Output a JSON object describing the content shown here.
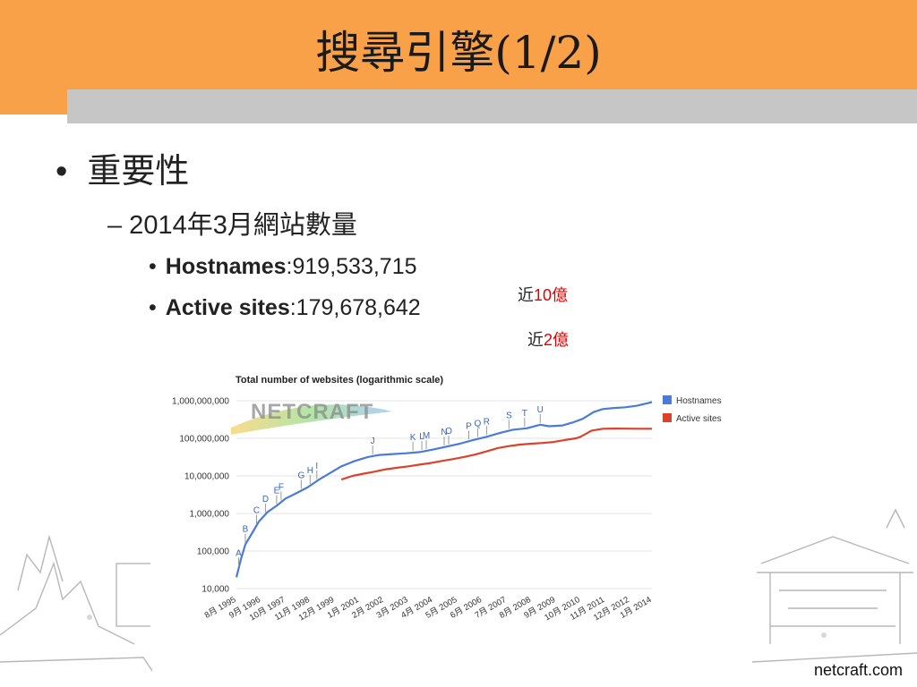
{
  "slide": {
    "title": "搜尋引擎(1/2)",
    "bullet1": "重要性",
    "bullet2": "– 2014年3月網站數量",
    "hostnames_label": "Hostnames",
    "hostnames_value": ":919,533,715",
    "active_label": "Active sites",
    "active_value": ":179,678,642",
    "note1_prefix": "近",
    "note1_num": "10",
    "note1_suffix": "億",
    "note2_prefix": "近",
    "note2_num": "2",
    "note2_suffix": "億",
    "source": "netcraft.com",
    "watermark": "NETCRAFT"
  },
  "colors": {
    "title_bar": "#f9a148",
    "gray_bar": "#c6c6c6",
    "hostnames": "#4a7bd6",
    "active": "#d9422b",
    "highlight": "#e00000"
  },
  "chart_data": {
    "type": "line",
    "title": "Total number of websites (logarithmic scale)",
    "xlabel": "",
    "ylabel": "",
    "yscale": "log",
    "ylim": [
      10000,
      1000000000
    ],
    "yticks": [
      1000000000,
      100000000,
      10000000,
      1000000,
      100000,
      10000
    ],
    "yticklabels": [
      "1,000,000,000",
      "100,000,000",
      "10,000,000",
      "1,000,000",
      "100,000",
      "10,000"
    ],
    "xlim": [
      1995.6,
      2014.2
    ],
    "xticks": [
      1995.6,
      1996.7,
      1997.8,
      1998.9,
      2000.0,
      2001.1,
      2002.2,
      2003.3,
      2004.4,
      2005.5,
      2006.6,
      2007.7,
      2008.8,
      2009.9,
      2011.0,
      2012.1,
      2013.2,
      2014.2
    ],
    "xticklabels": [
      "8月 1995",
      "9月 1996",
      "10月 1997",
      "11月 1998",
      "12月 1999",
      "1月 2001",
      "2月 2002",
      "3月 2003",
      "4月 2004",
      "5月 2005",
      "6月 2006",
      "7月 2007",
      "8月 2008",
      "9月 2009",
      "10月 2010",
      "11月 2011",
      "12月 2012",
      "1月 2014"
    ],
    "grid": true,
    "legend_position": "right",
    "series": [
      {
        "name": "Hostnames",
        "color": "#4a7bd6",
        "x": [
          1995.6,
          1995.8,
          1996.0,
          1996.3,
          1996.6,
          1997.0,
          1997.4,
          1997.8,
          1998.3,
          1998.8,
          1999.3,
          1999.8,
          2000.3,
          2000.9,
          2001.5,
          2002.0,
          2002.6,
          2003.2,
          2003.8,
          2004.4,
          2005.0,
          2005.6,
          2006.2,
          2006.8,
          2007.4,
          2008.0,
          2008.6,
          2009.2,
          2009.6,
          2010.2,
          2010.7,
          2011.1,
          2011.6,
          2012.0,
          2012.5,
          2013.0,
          2013.5,
          2014.0,
          2014.2
        ],
        "y": [
          20000,
          60000,
          150000,
          300000,
          600000,
          1100000,
          1600000,
          2500000,
          3500000,
          5000000,
          8000000,
          12000000,
          18000000,
          25000000,
          32000000,
          36000000,
          38000000,
          40000000,
          43000000,
          50000000,
          60000000,
          72000000,
          90000000,
          110000000,
          140000000,
          170000000,
          185000000,
          230000000,
          210000000,
          220000000,
          270000000,
          330000000,
          500000000,
          600000000,
          640000000,
          670000000,
          730000000,
          860000000,
          920000000
        ]
      },
      {
        "name": "Active sites",
        "color": "#d9422b",
        "x": [
          2000.3,
          2000.8,
          2001.3,
          2001.8,
          2002.3,
          2002.8,
          2003.3,
          2003.8,
          2004.3,
          2004.8,
          2005.3,
          2005.8,
          2006.3,
          2006.8,
          2007.3,
          2007.8,
          2008.3,
          2008.8,
          2009.3,
          2009.8,
          2010.3,
          2010.8,
          2011.0,
          2011.5,
          2012.0,
          2012.5,
          2013.0,
          2013.5,
          2014.0,
          2014.2
        ],
        "y": [
          8000000,
          10000000,
          11500000,
          13000000,
          15000000,
          16500000,
          18000000,
          20000000,
          22000000,
          25000000,
          28000000,
          32000000,
          37000000,
          45000000,
          55000000,
          62000000,
          68000000,
          72000000,
          75000000,
          80000000,
          90000000,
          100000000,
          110000000,
          160000000,
          180000000,
          182000000,
          181000000,
          180000000,
          180000000,
          179678642
        ]
      }
    ],
    "annotations": [
      {
        "label": "A",
        "x": 1995.7
      },
      {
        "label": "B",
        "x": 1996.0
      },
      {
        "label": "C",
        "x": 1996.5
      },
      {
        "label": "D",
        "x": 1996.9
      },
      {
        "label": "E",
        "x": 1997.4
      },
      {
        "label": "F",
        "x": 1997.6
      },
      {
        "label": "G",
        "x": 1998.5
      },
      {
        "label": "H",
        "x": 1998.9
      },
      {
        "label": "I",
        "x": 1999.2
      },
      {
        "label": "J",
        "x": 2001.7
      },
      {
        "label": "K",
        "x": 2003.5
      },
      {
        "label": "L",
        "x": 2003.9
      },
      {
        "label": "M",
        "x": 2004.1
      },
      {
        "label": "N",
        "x": 2004.9
      },
      {
        "label": "O",
        "x": 2005.1
      },
      {
        "label": "P",
        "x": 2006.0
      },
      {
        "label": "Q",
        "x": 2006.4
      },
      {
        "label": "R",
        "x": 2006.8
      },
      {
        "label": "S",
        "x": 2007.8
      },
      {
        "label": "T",
        "x": 2008.5
      },
      {
        "label": "U",
        "x": 2009.2
      }
    ]
  }
}
